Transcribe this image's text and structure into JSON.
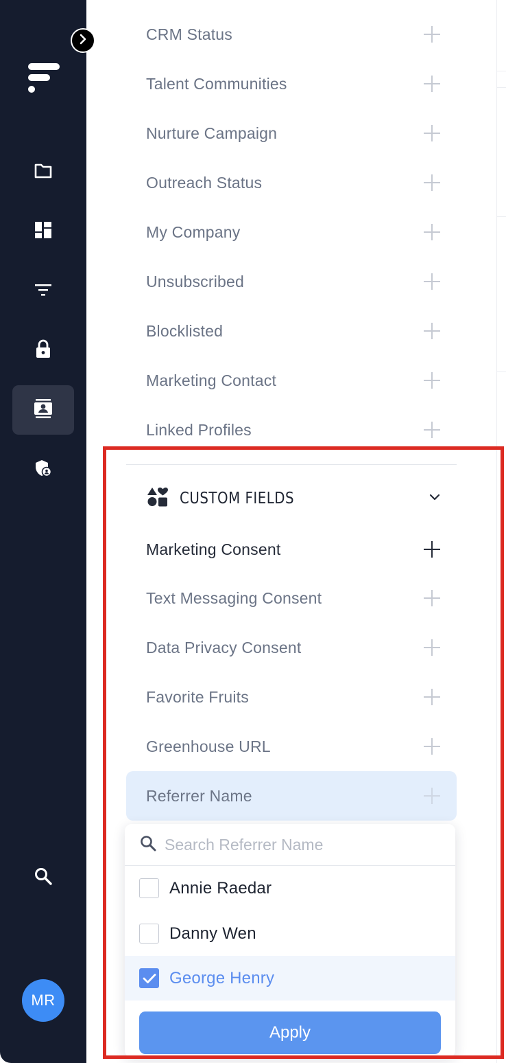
{
  "sidebar": {
    "expand_icon": "chevron-right-icon",
    "logo": "app-logo",
    "nav_items": [
      {
        "icon": "folder-icon"
      },
      {
        "icon": "dashboard-icon"
      },
      {
        "icon": "filter-icon"
      },
      {
        "icon": "lock-icon"
      },
      {
        "icon": "contact-card-icon",
        "active": true
      },
      {
        "icon": "shield-user-icon"
      }
    ],
    "search_icon": "search-icon",
    "avatar_initials": "MR",
    "avatar_color": "#3d8cf5",
    "background_color": "#151c2e"
  },
  "filters": {
    "standard_rows": [
      {
        "label": "CRM Status"
      },
      {
        "label": "Talent Communities"
      },
      {
        "label": "Nurture Campaign"
      },
      {
        "label": "Outreach Status"
      },
      {
        "label": "My Company"
      },
      {
        "label": "Unsubscribed"
      },
      {
        "label": "Blocklisted"
      },
      {
        "label": "Marketing Contact"
      },
      {
        "label": "Linked Profiles"
      }
    ],
    "custom_fields": {
      "title": "CUSTOM FIELDS",
      "icon": "shapes-icon",
      "expanded": true,
      "rows": [
        {
          "label": "Marketing Consent",
          "emphasized": true
        },
        {
          "label": "Text Messaging Consent"
        },
        {
          "label": "Data Privacy Consent"
        },
        {
          "label": "Favorite Fruits"
        },
        {
          "label": "Greenhouse URL"
        },
        {
          "label": "Referrer Name",
          "active": true
        }
      ]
    }
  },
  "dropdown": {
    "search_placeholder": "Search Referrer Name",
    "search_value": "",
    "options": [
      {
        "label": "Annie Raedar",
        "checked": false
      },
      {
        "label": "Danny Wen",
        "checked": false
      },
      {
        "label": "George Henry",
        "checked": true
      }
    ],
    "apply_label": "Apply",
    "accent_color": "#5b8def"
  },
  "annotation": {
    "frame_color": "#dc2a22"
  }
}
